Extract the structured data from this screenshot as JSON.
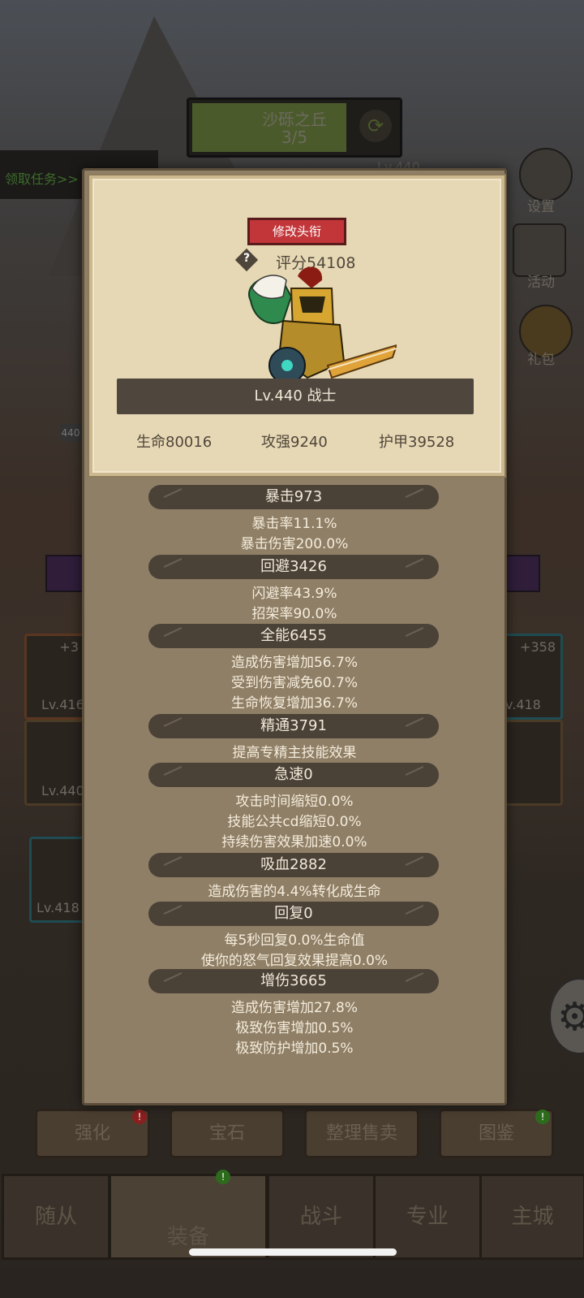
{
  "background": {
    "stage": {
      "name": "沙砾之丘",
      "progress": "3/5"
    },
    "task_text": "领取任务>>",
    "player_info": "Lv.440",
    "right_menu": [
      "设置",
      "活动",
      "礼包"
    ],
    "left_badge": "440",
    "slots": [
      {
        "plus": "+3",
        "level": "Lv.416"
      },
      {
        "level": "Lv.440"
      },
      {
        "plus": "+358",
        "level": "v.418"
      },
      {
        "level": "Lv.418"
      }
    ],
    "action_buttons": [
      "强化",
      "宝石",
      "整理售卖",
      "图鉴"
    ],
    "nav": [
      "随从",
      "装备",
      "战斗",
      "专业",
      "主城"
    ]
  },
  "popup": {
    "rename_button": "修改头衔",
    "score_icon": "?",
    "score": "评分54108",
    "level_class": "Lv.440 战士",
    "base_stats": {
      "hp": "生命80016",
      "attack": "攻强9240",
      "armor": "护甲39528"
    },
    "stat_groups": [
      {
        "header": "暴击973",
        "lines": [
          "暴击率11.1%",
          "暴击伤害200.0%"
        ]
      },
      {
        "header": "回避3426",
        "lines": [
          "闪避率43.9%",
          "招架率90.0%"
        ]
      },
      {
        "header": "全能6455",
        "lines": [
          "造成伤害增加56.7%",
          "受到伤害减免60.7%",
          "生命恢复增加36.7%"
        ]
      },
      {
        "header": "精通3791",
        "lines": [
          "提高专精主技能效果"
        ]
      },
      {
        "header": "急速0",
        "lines": [
          "攻击时间缩短0.0%",
          "技能公共cd缩短0.0%",
          "持续伤害效果加速0.0%"
        ]
      },
      {
        "header": "吸血2882",
        "lines": [
          "造成伤害的4.4%转化成生命"
        ]
      },
      {
        "header": "回复0",
        "lines": [
          "每5秒回复0.0%生命值",
          "使你的怒气回复效果提高0.0%"
        ]
      },
      {
        "header": "增伤3665",
        "lines": [
          "造成伤害增加27.8%",
          "极致伤害增加0.5%",
          "极致防护增加0.5%"
        ]
      }
    ]
  }
}
